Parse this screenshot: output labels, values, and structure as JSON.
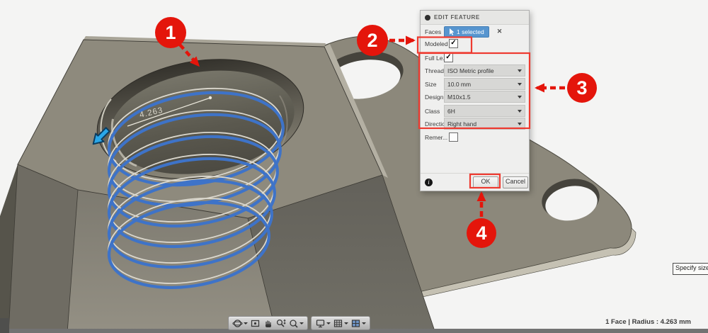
{
  "dialog": {
    "title": "EDIT FEATURE",
    "check_glyph": "✓",
    "faces": {
      "label": "Faces",
      "chip": "1 selected",
      "close": "✕"
    },
    "modeled": {
      "label": "Modeled",
      "checked": true
    },
    "full_length": {
      "label": "Full Le...",
      "checked": true
    },
    "dropdowns": [
      {
        "label": "Thread...",
        "value": "ISO Metric profile"
      },
      {
        "label": "Size",
        "value": "10.0 mm"
      },
      {
        "label": "Design...",
        "value": "M10x1.5"
      },
      {
        "label": "Class",
        "value": "6H"
      },
      {
        "label": "Directio...",
        "value": "Right hand"
      }
    ],
    "remember": {
      "label": "Remer...",
      "checked": false
    },
    "buttons": {
      "ok": "OK",
      "cancel": "Cancel"
    },
    "info_icon": "i"
  },
  "annotations": {
    "steps": [
      "1",
      "2",
      "3",
      "4"
    ],
    "accent_color": "#e4150b"
  },
  "viewport": {
    "dimension_label": "4.263",
    "thread_color": "#3e73c8",
    "model_color": "#8c887b",
    "selection_cursor_color": "#2aa7e8"
  },
  "toolbar": {
    "icons": [
      "orbit",
      "look-at",
      "pan",
      "zoom",
      "fit",
      "display-settings",
      "grid-layout",
      "viewports"
    ]
  },
  "statusbar": {
    "selection_info": "1 Face | Radius : 4.263 mm"
  },
  "tooltip": {
    "text": "Specify size, c"
  }
}
